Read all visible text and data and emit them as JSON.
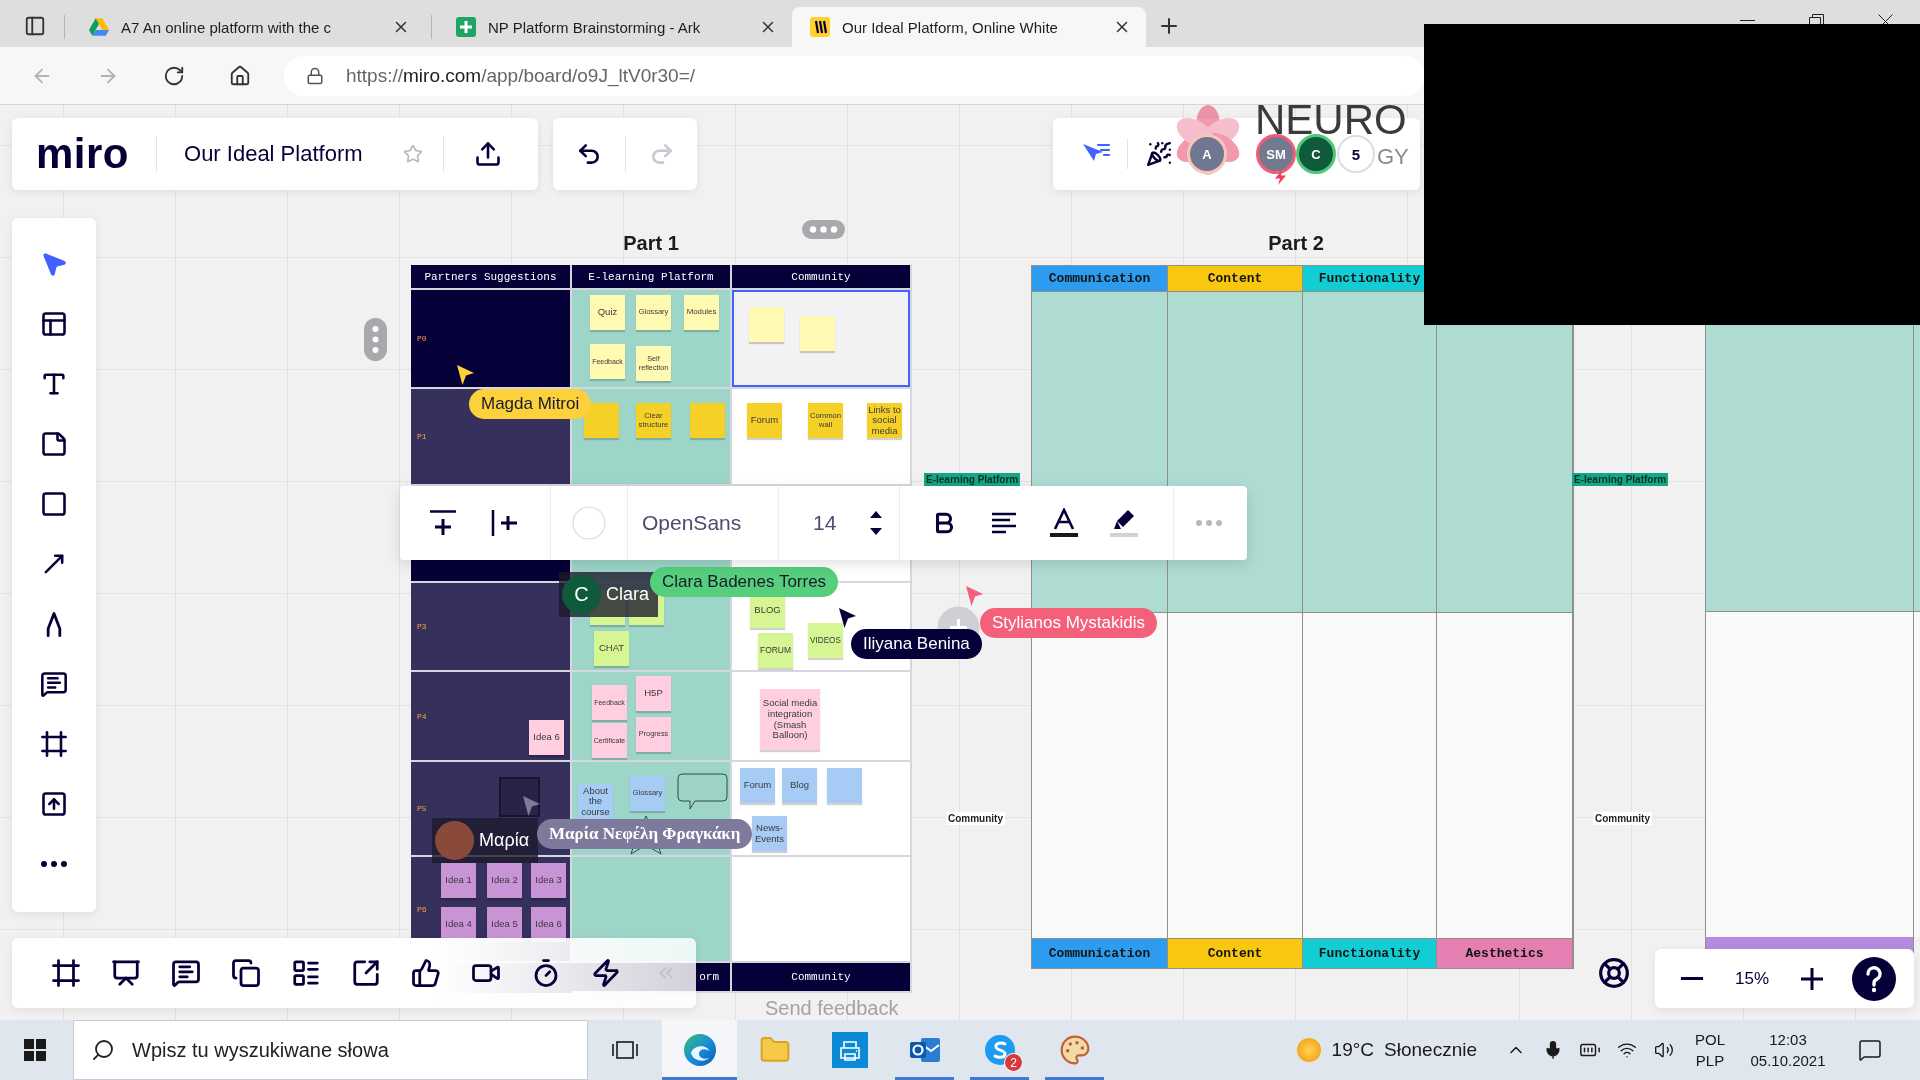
{
  "browser": {
    "tabs": [
      {
        "kind": "drive",
        "title": "A7 An online platform with the c",
        "selected": false
      },
      {
        "kind": "sheets",
        "title": "NP Platform Brainstorming - Ark",
        "selected": false
      },
      {
        "kind": "miro",
        "title": "Our Ideal Platform, Online White",
        "selected": true
      }
    ],
    "nav": {
      "back_disabled": true,
      "forward_disabled": true
    },
    "url": {
      "scheme": "https://",
      "host": "miro.com",
      "path": "/app/board/o9J_ltV0r30=/"
    }
  },
  "board_header": {
    "logo": "miro",
    "title": "Our Ideal Platform",
    "starred": false,
    "undo_disabled": false,
    "redo_disabled": true
  },
  "presence": {
    "collaborators": [
      {
        "initials": "A",
        "color": "#6f7890",
        "ring": {
          "color": "#f6c6bd"
        },
        "kind": "plain"
      },
      {
        "initials": "SM",
        "color": "#737a90",
        "ring": {
          "color": "#ef5d78"
        },
        "kind": "bolt"
      },
      {
        "initials": "C",
        "color": "#0e5a3a",
        "ring": {
          "color": "#4cc97a"
        },
        "kind": "plain"
      }
    ],
    "more_count": "5"
  },
  "board_logo": {
    "text": "NEURO",
    "tail": "GY"
  },
  "left_tools": [
    {
      "kind": "select",
      "selected": true
    },
    {
      "kind": "templates",
      "selected": false
    },
    {
      "kind": "text",
      "selected": false
    },
    {
      "kind": "sticky",
      "selected": false
    },
    {
      "kind": "shape",
      "selected": false
    },
    {
      "kind": "line",
      "selected": false
    },
    {
      "kind": "pen",
      "selected": false
    },
    {
      "kind": "comment",
      "selected": false
    },
    {
      "kind": "frame",
      "selected": false
    },
    {
      "kind": "upload",
      "selected": false
    },
    {
      "kind": "more",
      "selected": false
    }
  ],
  "part1": {
    "title": "Part 1",
    "columns": [
      "Partners Suggestions",
      "E-learning Platform",
      "Community"
    ],
    "rows": [
      {
        "label": "P0",
        "color": "#050038",
        "cells": [
          {
            "selected": false
          },
          {
            "selected": false,
            "notes": [
              {
                "text": "Quiz",
                "color": "#fff9b1"
              },
              {
                "text": "Glossary",
                "color": "#fff9b1"
              },
              {
                "text": "Modules",
                "color": "#fff9b1"
              },
              {
                "text": "Feedback",
                "color": "#fff9b1"
              },
              {
                "text": "Self reflection",
                "color": "#fff9b1"
              }
            ]
          },
          {
            "selected": true,
            "notes": [
              {
                "color": "#fff9b1"
              },
              {
                "color": "#fff9b1"
              }
            ]
          }
        ]
      },
      {
        "label": "P1",
        "color": "#35305c",
        "cells": [
          {
            "selected": false
          },
          {
            "selected": false,
            "notes": [
              {
                "color": "#f5d128"
              },
              {
                "text": "Clear structure",
                "color": "#f5d128"
              },
              {
                "color": "#f5d128"
              }
            ]
          },
          {
            "selected": false,
            "notes": [
              {
                "text": "Forum",
                "color": "#f5d128"
              },
              {
                "text": "Common wall",
                "color": "#f5d128"
              },
              {
                "text": "Links to social media",
                "color": "#f5d128"
              }
            ]
          }
        ]
      },
      {
        "color": "#050038",
        "cells": [
          {
            "selected": false
          },
          {
            "selected": false
          },
          {
            "selected": false
          }
        ]
      },
      {
        "label": "P3",
        "color": "#35305c",
        "cells": [
          {
            "selected": false
          },
          {
            "selected": false,
            "notes": [
              {
                "color": "#d5f692"
              },
              {
                "color": "#d5f692"
              },
              {
                "text": "CHAT",
                "color": "#d5f692"
              }
            ]
          },
          {
            "selected": false,
            "notes": [
              {
                "text": "BLOG",
                "color": "#d5f692"
              },
              {
                "text": "FORUM",
                "color": "#d5f692"
              },
              {
                "text": "VIDEOS",
                "color": "#d5f692"
              }
            ]
          }
        ]
      },
      {
        "label": "P4",
        "color": "#35305c",
        "cells": [
          {
            "selected": false,
            "notes": [
              {
                "text": "Idea 6",
                "color": "#ffcee0"
              }
            ]
          },
          {
            "selected": false,
            "notes": [
              {
                "text": "Feedback",
                "color": "#ffcee0"
              },
              {
                "text": "H5P",
                "color": "#ffcee0"
              },
              {
                "text": "Certificate",
                "color": "#ffcee0"
              },
              {
                "text": "Progress",
                "color": "#ffcee0"
              }
            ]
          },
          {
            "selected": false,
            "notes": [
              {
                "text": "Social media integration (Smash Balloon)",
                "color": "#ffcee0"
              }
            ]
          }
        ]
      },
      {
        "label": "P5",
        "color": "#35305c",
        "cells": [
          {
            "selected": false
          },
          {
            "selected": false,
            "notes": [
              {
                "kind": "note",
                "text": "About the course",
                "color": "#a6ccf5"
              },
              {
                "kind": "note",
                "text": "Glossary",
                "color": "#a6ccf5"
              },
              {
                "kind": "bubble"
              },
              {
                "kind": "star"
              }
            ]
          },
          {
            "selected": false,
            "notes": [
              {
                "text": "Forum",
                "color": "#a6ccf5"
              },
              {
                "text": "Blog",
                "color": "#a6ccf5"
              },
              {
                "color": "#a6ccf5"
              },
              {
                "text": "News-Events",
                "color": "#a6ccf5"
              }
            ]
          }
        ]
      },
      {
        "label": "P6",
        "color": "#35305c",
        "cells": [
          {
            "selected": false,
            "notes": [
              {
                "text": "Idea 1",
                "color": "#c994d6"
              },
              {
                "text": "Idea 2",
                "color": "#c994d6"
              },
              {
                "text": "Idea 3",
                "color": "#c994d6"
              },
              {
                "text": "Idea 4",
                "color": "#c994d6"
              },
              {
                "text": "Idea 5",
                "color": "#c994d6"
              },
              {
                "text": "Idea 6",
                "color": "#c994d6"
              }
            ]
          },
          {
            "selected": false
          },
          {
            "selected": false
          }
        ]
      }
    ],
    "footer": [
      "orm",
      "Community"
    ]
  },
  "side_labels": [
    {
      "tag": "E-learning Platform",
      "plain": "Community"
    },
    {
      "tag": "E-learning Platform",
      "plain": "Community"
    }
  ],
  "part2": {
    "title": "Part 2",
    "columns": [
      {
        "text": "Communication",
        "color": "#2d9bf0"
      },
      {
        "text": "Content",
        "color": "#fac710"
      },
      {
        "text": "Functionality",
        "color": "#12cdd4"
      }
    ],
    "footer": [
      {
        "text": "Communication",
        "color": "#2d9bf0"
      },
      {
        "text": "Content",
        "color": "#fac710"
      },
      {
        "text": "Functionality",
        "color": "#12cdd4"
      },
      {
        "text": "Aesthetics",
        "color": "#e67fb1"
      }
    ]
  },
  "cursors": [
    {
      "kind": "plain",
      "name": "Magda Mitroi",
      "color": "#fcd13c"
    },
    {
      "kind": "card",
      "name": "Clara Badenes Torres",
      "first_name": "Clara",
      "avatar": {
        "initial": "C",
        "color": "#0e5a3a"
      },
      "color": "#55cf7c"
    },
    {
      "kind": "plain",
      "name": "Iliyana Benina",
      "color": "#050038"
    },
    {
      "kind": "plus",
      "name": "Stylianos Mystakidis",
      "color": "#f4607a"
    },
    {
      "kind": "photo",
      "name": "Μαρία Νεφέλη Φραγκάκη",
      "first_name": "Μαρία",
      "color": "#7e7a9c"
    }
  ],
  "text_toolbar": {
    "font": "OpenSans",
    "size": "14"
  },
  "bottom_tools": [
    {
      "kind": "frames"
    },
    {
      "kind": "presentation"
    },
    {
      "kind": "comments"
    },
    {
      "kind": "cards"
    },
    {
      "kind": "list"
    },
    {
      "kind": "export"
    },
    {
      "kind": "reactions"
    },
    {
      "kind": "video"
    },
    {
      "kind": "timer"
    },
    {
      "kind": "lightning"
    },
    {
      "kind": "collapse"
    }
  ],
  "zoom": {
    "value": "15%"
  },
  "feedback": "Send feedback",
  "taskbar": {
    "search_placeholder": "Wpisz tu wyszukiwane słowa",
    "apps": [
      {
        "kind": "browser",
        "selected": true,
        "running": true
      },
      {
        "kind": "explorer",
        "selected": false,
        "running": false
      },
      {
        "kind": "printer",
        "selected": false,
        "running": false
      },
      {
        "kind": "mail",
        "selected": false,
        "running": true
      },
      {
        "kind": "chat",
        "selected": false,
        "running": true,
        "badge": "2"
      },
      {
        "kind": "paint",
        "selected": false,
        "running": true
      }
    ],
    "weather": {
      "temperature": "19°C",
      "condition": "Słonecznie"
    },
    "language": {
      "top": "POL",
      "bottom": "PLP"
    },
    "clock": {
      "time": "12:03",
      "date": "05.10.2021"
    }
  }
}
